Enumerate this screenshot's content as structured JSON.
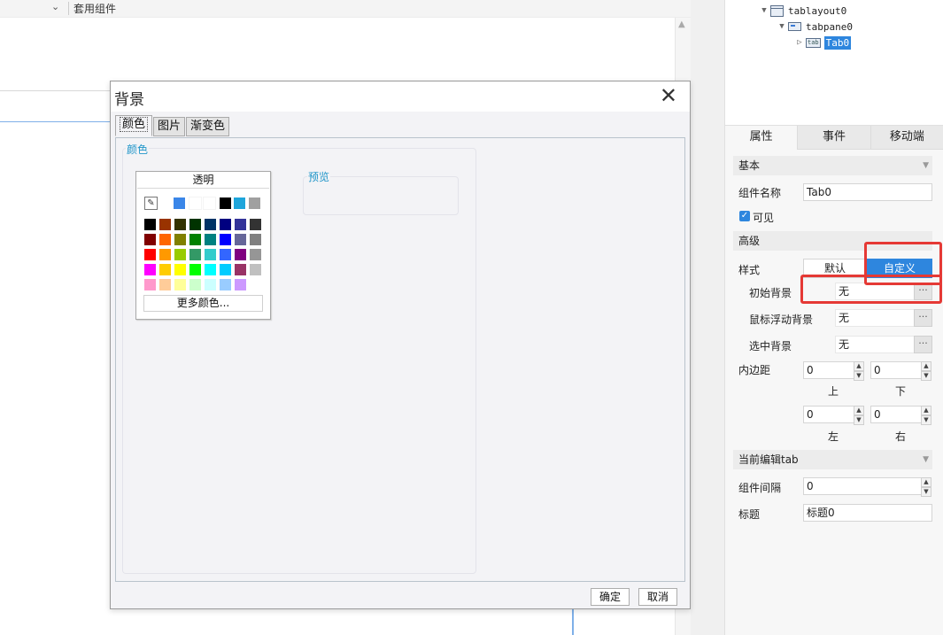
{
  "toolbar": {
    "apply_component": "套用组件"
  },
  "tree": {
    "items": [
      {
        "name": "tablayout0"
      },
      {
        "name": "tabpane0"
      },
      {
        "name": "Tab0"
      }
    ]
  },
  "panel_tabs": [
    "属性",
    "事件",
    "移动端"
  ],
  "props": {
    "basic_section": "基本",
    "component_name_label": "组件名称",
    "component_name_value": "Tab0",
    "visible_label": "可见",
    "advanced_section": "高级",
    "style_label": "样式",
    "style_default": "默认",
    "style_custom": "自定义",
    "initial_bg_label": "初始背景",
    "initial_bg_value": "无",
    "hover_bg_label": "鼠标浮动背景",
    "hover_bg_value": "无",
    "selected_bg_label": "选中背景",
    "selected_bg_value": "无",
    "padding_label": "内边距",
    "padding_top": "0",
    "padding_bottom": "0",
    "padding_left": "0",
    "padding_right": "0",
    "top_label": "上",
    "bottom_label": "下",
    "left_label": "左",
    "right_label": "右",
    "current_tab_section": "当前编辑tab",
    "gap_label": "组件间隔",
    "gap_value": "0",
    "title_label": "标题",
    "title_value": "标题0"
  },
  "dialog": {
    "title": "背景",
    "tabs": [
      "颜色",
      "图片",
      "渐变色"
    ],
    "color_group_label": "颜色",
    "preview_label": "预览",
    "transparent_label": "透明",
    "more_colors_label": "更多颜色...",
    "ok_label": "确定",
    "cancel_label": "取消",
    "recent_colors": [
      "#3a86e8",
      "#ffffff",
      "#ffffff",
      "#000000",
      "#1ea5db",
      "#a0a0a0"
    ],
    "palette_rows": [
      [
        "#000000",
        "#993300",
        "#333300",
        "#003300",
        "#003366",
        "#000080",
        "#333399",
        "#333333"
      ],
      [
        "#800000",
        "#ff6600",
        "#808000",
        "#008000",
        "#008080",
        "#0000ff",
        "#666699",
        "#808080"
      ],
      [
        "#ff0000",
        "#ff9900",
        "#99cc00",
        "#339966",
        "#33cccc",
        "#3366ff",
        "#800080",
        "#969696"
      ],
      [
        "#ff00ff",
        "#ffcc00",
        "#ffff00",
        "#00ff00",
        "#00ffff",
        "#00ccff",
        "#993366",
        "#c0c0c0"
      ],
      [
        "#ff99cc",
        "#ffcc99",
        "#ffff99",
        "#ccffcc",
        "#ccffff",
        "#99ccff",
        "#cc99ff",
        "#ffffff"
      ]
    ]
  },
  "highlight_color": "#e53935",
  "accent_color": "#2e86de"
}
